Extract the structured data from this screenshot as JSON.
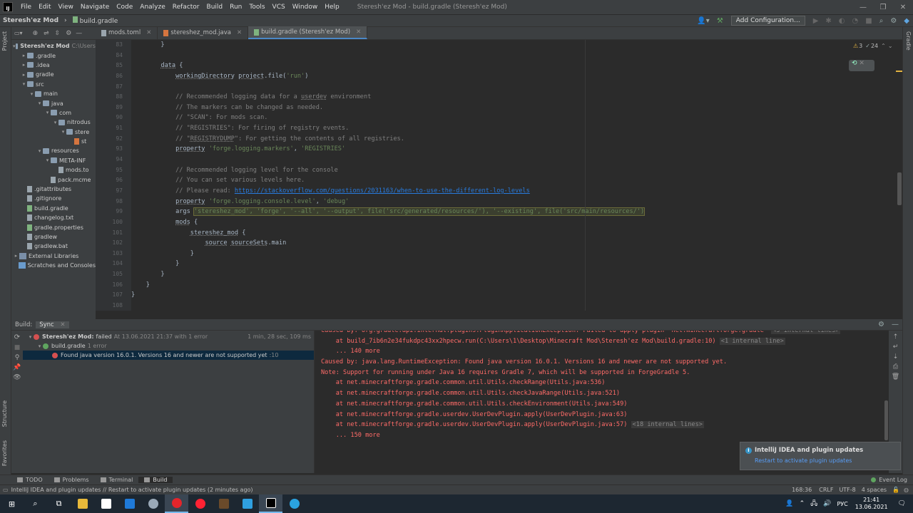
{
  "window": {
    "title": "Steresh'ez Mod - build.gradle (Steresh'ez Mod)",
    "menu": [
      "File",
      "Edit",
      "View",
      "Navigate",
      "Code",
      "Analyze",
      "Refactor",
      "Build",
      "Run",
      "Tools",
      "VCS",
      "Window",
      "Help"
    ]
  },
  "navbar": {
    "project": "Steresh'ez Mod",
    "file": "build.gradle",
    "add_config": "Add Configuration..."
  },
  "tabs": [
    {
      "label": "mods.toml",
      "active": false
    },
    {
      "label": "stereshez_mod.java",
      "active": false
    },
    {
      "label": "build.gradle (Steresh'ez Mod)",
      "active": true
    }
  ],
  "inspections": {
    "warnings": "3",
    "weak": "24"
  },
  "side": {
    "project": "Project",
    "structure": "Structure",
    "favorites": "Favorites",
    "gradle": "Gradle"
  },
  "project_tree": [
    {
      "label": "Steresh'ez Mod",
      "extra": "C:\\Users",
      "depth": 0,
      "arrow": "▾",
      "icon": "folder",
      "bold": true
    },
    {
      "label": ".gradle",
      "depth": 1,
      "arrow": "▸",
      "icon": "folder"
    },
    {
      "label": ".idea",
      "depth": 1,
      "arrow": "▸",
      "icon": "folder"
    },
    {
      "label": "gradle",
      "depth": 1,
      "arrow": "▸",
      "icon": "folder"
    },
    {
      "label": "src",
      "depth": 1,
      "arrow": "▾",
      "icon": "folder"
    },
    {
      "label": "main",
      "depth": 2,
      "arrow": "▾",
      "icon": "folder"
    },
    {
      "label": "java",
      "depth": 3,
      "arrow": "▾",
      "icon": "folder"
    },
    {
      "label": "com",
      "depth": 4,
      "arrow": "▾",
      "icon": "folder"
    },
    {
      "label": "nitrodus",
      "depth": 5,
      "arrow": "▾",
      "icon": "folder"
    },
    {
      "label": "stere",
      "depth": 6,
      "arrow": "▾",
      "icon": "folder"
    },
    {
      "label": "st",
      "depth": 7,
      "arrow": "",
      "icon": "java"
    },
    {
      "label": "resources",
      "depth": 3,
      "arrow": "▾",
      "icon": "folder"
    },
    {
      "label": "META-INF",
      "depth": 4,
      "arrow": "▾",
      "icon": "folder"
    },
    {
      "label": "mods.to",
      "depth": 5,
      "arrow": "",
      "icon": "file"
    },
    {
      "label": "pack.mcme",
      "depth": 4,
      "arrow": "",
      "icon": "file"
    },
    {
      "label": ".gitattributes",
      "depth": 1,
      "arrow": "",
      "icon": "file"
    },
    {
      "label": ".gitignore",
      "depth": 1,
      "arrow": "",
      "icon": "file"
    },
    {
      "label": "build.gradle",
      "depth": 1,
      "arrow": "",
      "icon": "gradle"
    },
    {
      "label": "changelog.txt",
      "depth": 1,
      "arrow": "",
      "icon": "file"
    },
    {
      "label": "gradle.properties",
      "depth": 1,
      "arrow": "",
      "icon": "gradle"
    },
    {
      "label": "gradlew",
      "depth": 1,
      "arrow": "",
      "icon": "file"
    },
    {
      "label": "gradlew.bat",
      "depth": 1,
      "arrow": "",
      "icon": "file"
    },
    {
      "label": "External Libraries",
      "depth": 0,
      "arrow": "▸",
      "icon": "lib"
    },
    {
      "label": "Scratches and Consoles",
      "depth": 0,
      "arrow": "",
      "icon": "scratch"
    }
  ],
  "editor": {
    "line_numbers": [
      "83",
      "84",
      "85",
      "86",
      "87",
      "88",
      "89",
      "90",
      "91",
      "92",
      "93",
      "94",
      "95",
      "96",
      "97",
      "98",
      "99",
      "100",
      "101",
      "102",
      "103",
      "104",
      "105",
      "106",
      "107",
      "108"
    ],
    "lines": [
      [
        {
          "t": "        }",
          "c": ""
        }
      ],
      [
        {
          "t": "",
          "c": ""
        }
      ],
      [
        {
          "t": "        ",
          "c": ""
        },
        {
          "t": "data",
          "c": "dotu"
        },
        {
          "t": " {",
          "c": ""
        }
      ],
      [
        {
          "t": "            ",
          "c": ""
        },
        {
          "t": "workingDirectory",
          "c": "dotu"
        },
        {
          "t": " ",
          "c": ""
        },
        {
          "t": "project",
          "c": "dotu"
        },
        {
          "t": ".file(",
          "c": ""
        },
        {
          "t": "'run'",
          "c": "st"
        },
        {
          "t": ")",
          "c": ""
        }
      ],
      [
        {
          "t": "",
          "c": ""
        }
      ],
      [
        {
          "t": "            // Recommended logging data for a ",
          "c": "cm"
        },
        {
          "t": "userdev",
          "c": "cm dotu"
        },
        {
          "t": " environment",
          "c": "cm"
        }
      ],
      [
        {
          "t": "            // The markers can be changed as needed.",
          "c": "cm"
        }
      ],
      [
        {
          "t": "            // \"SCAN\": For mods scan.",
          "c": "cm"
        }
      ],
      [
        {
          "t": "            // \"REGISTRIES\": For firing of registry events.",
          "c": "cm"
        }
      ],
      [
        {
          "t": "            // \"",
          "c": "cm"
        },
        {
          "t": "REGISTRYDUMP",
          "c": "cm dotu"
        },
        {
          "t": "\": For getting the contents of all registries.",
          "c": "cm"
        }
      ],
      [
        {
          "t": "            ",
          "c": ""
        },
        {
          "t": "property",
          "c": "dotu"
        },
        {
          "t": " ",
          "c": ""
        },
        {
          "t": "'forge.logging.markers'",
          "c": "st"
        },
        {
          "t": ", ",
          "c": ""
        },
        {
          "t": "'REGISTRIES'",
          "c": "st"
        }
      ],
      [
        {
          "t": "",
          "c": ""
        }
      ],
      [
        {
          "t": "            // Recommended logging level for the console",
          "c": "cm"
        }
      ],
      [
        {
          "t": "            // You can set various levels here.",
          "c": "cm"
        }
      ],
      [
        {
          "t": "            // Please read: ",
          "c": "cm"
        },
        {
          "t": "https://stackoverflow.com/questions/2031163/when-to-use-the-different-log-levels",
          "c": "lk"
        }
      ],
      [
        {
          "t": "            ",
          "c": ""
        },
        {
          "t": "property",
          "c": "dotu"
        },
        {
          "t": " ",
          "c": ""
        },
        {
          "t": "'forge.logging.console.level'",
          "c": "st"
        },
        {
          "t": ", ",
          "c": ""
        },
        {
          "t": "'debug'",
          "c": "st"
        }
      ],
      [
        {
          "t": "            args ",
          "c": ""
        },
        {
          "t": "'stereshez_mod', 'forge', '--all', '--output', file('src/generated/resources/'), '--existing', file('src/main/resources/')",
          "c": "st hl"
        }
      ],
      [
        {
          "t": "            ",
          "c": ""
        },
        {
          "t": "mods",
          "c": "dotu"
        },
        {
          "t": " {",
          "c": ""
        }
      ],
      [
        {
          "t": "                ",
          "c": ""
        },
        {
          "t": "stereshez_mod",
          "c": "dotu"
        },
        {
          "t": " {",
          "c": ""
        }
      ],
      [
        {
          "t": "                    ",
          "c": ""
        },
        {
          "t": "source",
          "c": "dotu"
        },
        {
          "t": " ",
          "c": ""
        },
        {
          "t": "sourceSets",
          "c": "dotu"
        },
        {
          "t": ".main",
          "c": ""
        }
      ],
      [
        {
          "t": "                }",
          "c": ""
        }
      ],
      [
        {
          "t": "            }",
          "c": ""
        }
      ],
      [
        {
          "t": "        }",
          "c": ""
        }
      ],
      [
        {
          "t": "    }",
          "c": ""
        }
      ],
      [
        {
          "t": "}",
          "c": ""
        }
      ],
      [
        {
          "t": "",
          "c": ""
        }
      ]
    ]
  },
  "build": {
    "tab_label": "Build:",
    "sync_label": "Sync",
    "tree": [
      {
        "label": "Steresh'ez Mod:",
        "status": "failed",
        "extra": "At 13.06.2021 21:37 with 1 error",
        "time": "1 min, 28 sec, 109 ms",
        "depth": 0,
        "icon": "err"
      },
      {
        "label": "build.gradle",
        "extra": "1 error",
        "depth": 1,
        "icon": "ok"
      },
      {
        "label": "Found java version 16.0.1. Versions 16 and newer are not supported yet",
        "extra": ":10",
        "depth": 2,
        "icon": "err",
        "selected": true
      }
    ],
    "console": [
      {
        "t": "Caused by: org.gradle.api.internal.plugins.PluginApplicationException: Failed to apply plugin 'net.minecraftforge.gradle'",
        "i": "<9 internal lines>"
      },
      {
        "t": "    at build_7ib6n2e34fukdpc43xx2hpecw.run(C:\\Users\\1\\Desktop\\Minecraft Mod\\Steresh'ez Mod\\build.gradle:10)",
        "i": "<1 internal line>"
      },
      {
        "t": "    ... 140 more",
        "i": ""
      },
      {
        "t": "Caused by: java.lang.RuntimeException: Found java version 16.0.1. Versions 16 and newer are not supported yet.",
        "i": ""
      },
      {
        "t": "Note: Support for running under Java 16 requires Gradle 7, which will be supported in ForgeGradle 5.",
        "i": ""
      },
      {
        "t": "    at net.minecraftforge.gradle.common.util.Utils.checkRange(Utils.java:536)",
        "i": ""
      },
      {
        "t": "    at net.minecraftforge.gradle.common.util.Utils.checkJavaRange(Utils.java:521)",
        "i": ""
      },
      {
        "t": "    at net.minecraftforge.gradle.common.util.Utils.checkEnvironment(Utils.java:549)",
        "i": ""
      },
      {
        "t": "    at net.minecraftforge.gradle.userdev.UserDevPlugin.apply(UserDevPlugin.java:63)",
        "i": ""
      },
      {
        "t": "    at net.minecraftforge.gradle.userdev.UserDevPlugin.apply(UserDevPlugin.java:57)",
        "i": "<18 internal lines>"
      },
      {
        "t": "    ... 150 more",
        "i": ""
      }
    ]
  },
  "notification": {
    "title": "IntelliJ IDEA and plugin updates",
    "link": "Restart to activate plugin updates"
  },
  "bottom_tabs": [
    "TODO",
    "Problems",
    "Terminal",
    "Build"
  ],
  "event_log": "Event Log",
  "status": {
    "message": "IntelliJ IDEA and plugin updates // Restart to activate plugin updates (2 minutes ago)",
    "position": "168:36",
    "line_sep": "CRLF",
    "encoding": "UTF-8",
    "indent": "4 spaces"
  },
  "taskbar": {
    "lang": "РУС",
    "time": "21:41",
    "date": "13.06.2021"
  },
  "colors": {
    "accent": "#4a88c7",
    "error": "#ff6b68",
    "comment": "#808080",
    "string": "#6a8759",
    "link": "#287bde"
  }
}
